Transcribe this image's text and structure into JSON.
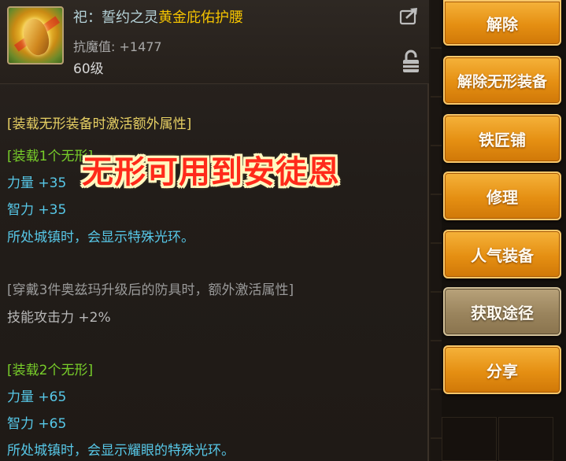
{
  "item": {
    "name_prefix": "祀：誓约之灵",
    "name_main": "黄金庇佑护腰",
    "resist": "抗魔值: +1477",
    "level": "60级"
  },
  "sections": {
    "invisible_header": "[装载无形装备时激活额外属性]",
    "set1_title": "[装载1个无形]",
    "set1_str": "力量 +35",
    "set1_int": "智力 +35",
    "set1_town": "所处城镇时，会显示特殊光环。",
    "ozma_header": "[穿戴3件奥兹玛升级后的防具时，额外激活属性]",
    "ozma_skill": "技能攻击力 +2%",
    "set2_title": "[装载2个无形]",
    "set2_str": "力量 +65",
    "set2_int": "智力 +65",
    "set2_town": "所处城镇时，会显示耀眼的特殊光环。"
  },
  "overlay_caption": "无形可用到安徒恩",
  "buttons": {
    "unequip": "解除",
    "unequip_invisible": "解除无形装备",
    "blacksmith": "铁匠铺",
    "repair": "修理",
    "popular": "人气装备",
    "obtain": "获取途径",
    "share": "分享"
  },
  "icons": {
    "item": "golden-belt-icon",
    "share": "share-arrow-icon",
    "lock": "padlock-icon"
  },
  "colors": {
    "name_gold": "#f5c400",
    "set_green": "#78ce2a",
    "stat_cyan": "#57c8e8",
    "header_yellow": "#e7d064",
    "button_orange": "#e58f12",
    "overlay_red": "#ff2a1a"
  }
}
